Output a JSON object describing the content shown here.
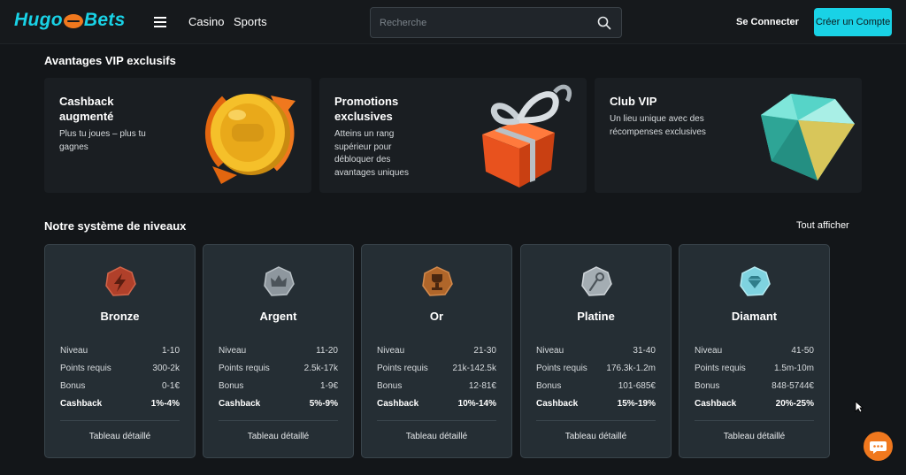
{
  "header": {
    "logo": {
      "part1": "Hugo",
      "part2": "Bets"
    },
    "nav": [
      "Casino",
      "Sports"
    ],
    "search_placeholder": "Recherche",
    "connect_label": "Se Connecter",
    "signup_label": "Créer un Compte"
  },
  "vip": {
    "title": "Avantages VIP exclusifs",
    "cards": [
      {
        "title_line1": "Cashback",
        "title_line2": "augmenté",
        "desc": [
          "Plus tu joues – plus tu",
          "gagnes"
        ],
        "art": "gold-coin-icon"
      },
      {
        "title_line1": "Promotions",
        "title_line2": "exclusives",
        "desc": [
          "Atteins un rang",
          "supérieur pour",
          "débloquer des",
          "avantages uniques"
        ],
        "art": "gift-box-icon"
      },
      {
        "title_line1": "Club VIP",
        "title_line2": "",
        "desc": [
          "Un lieu unique avec des",
          "récompenses exclusives"
        ],
        "art": "diamond-icon"
      }
    ]
  },
  "levels": {
    "title": "Notre système de niveaux",
    "show_all": "Tout afficher",
    "detail_label": "Tableau détaillé",
    "row_labels": {
      "level": "Niveau",
      "points": "Points requis",
      "bonus": "Bonus",
      "cashback": "Cashback"
    },
    "items": [
      {
        "name": "Bronze",
        "level": "1-10",
        "points": "300-2k",
        "bonus": "0-1€",
        "cashback": "1%-4%",
        "badge_color": "#b0402a",
        "badge_icon": "lightning-icon"
      },
      {
        "name": "Argent",
        "level": "11-20",
        "points": "2.5k-17k",
        "bonus": "1-9€",
        "cashback": "5%-9%",
        "badge_color": "#8e979e",
        "badge_icon": "crown-icon"
      },
      {
        "name": "Or",
        "level": "21-30",
        "points": "21k-142.5k",
        "bonus": "12-81€",
        "cashback": "10%-14%",
        "badge_color": "#b0662a",
        "badge_icon": "trophy-icon"
      },
      {
        "name": "Platine",
        "level": "31-40",
        "points": "176.3k-1.2m",
        "bonus": "101-685€",
        "cashback": "15%-19%",
        "badge_color": "#a4adb3",
        "badge_icon": "scepter-icon"
      },
      {
        "name": "Diamant",
        "level": "41-50",
        "points": "1.5m-10m",
        "bonus": "848-5744€",
        "cashback": "20%-25%",
        "badge_color": "#7fd3e0",
        "badge_icon": "gem-icon"
      }
    ]
  },
  "colors": {
    "accent": "#19d2e6",
    "orange": "#f0781e",
    "card_bg": "#252e34",
    "page_bg": "#131619"
  }
}
